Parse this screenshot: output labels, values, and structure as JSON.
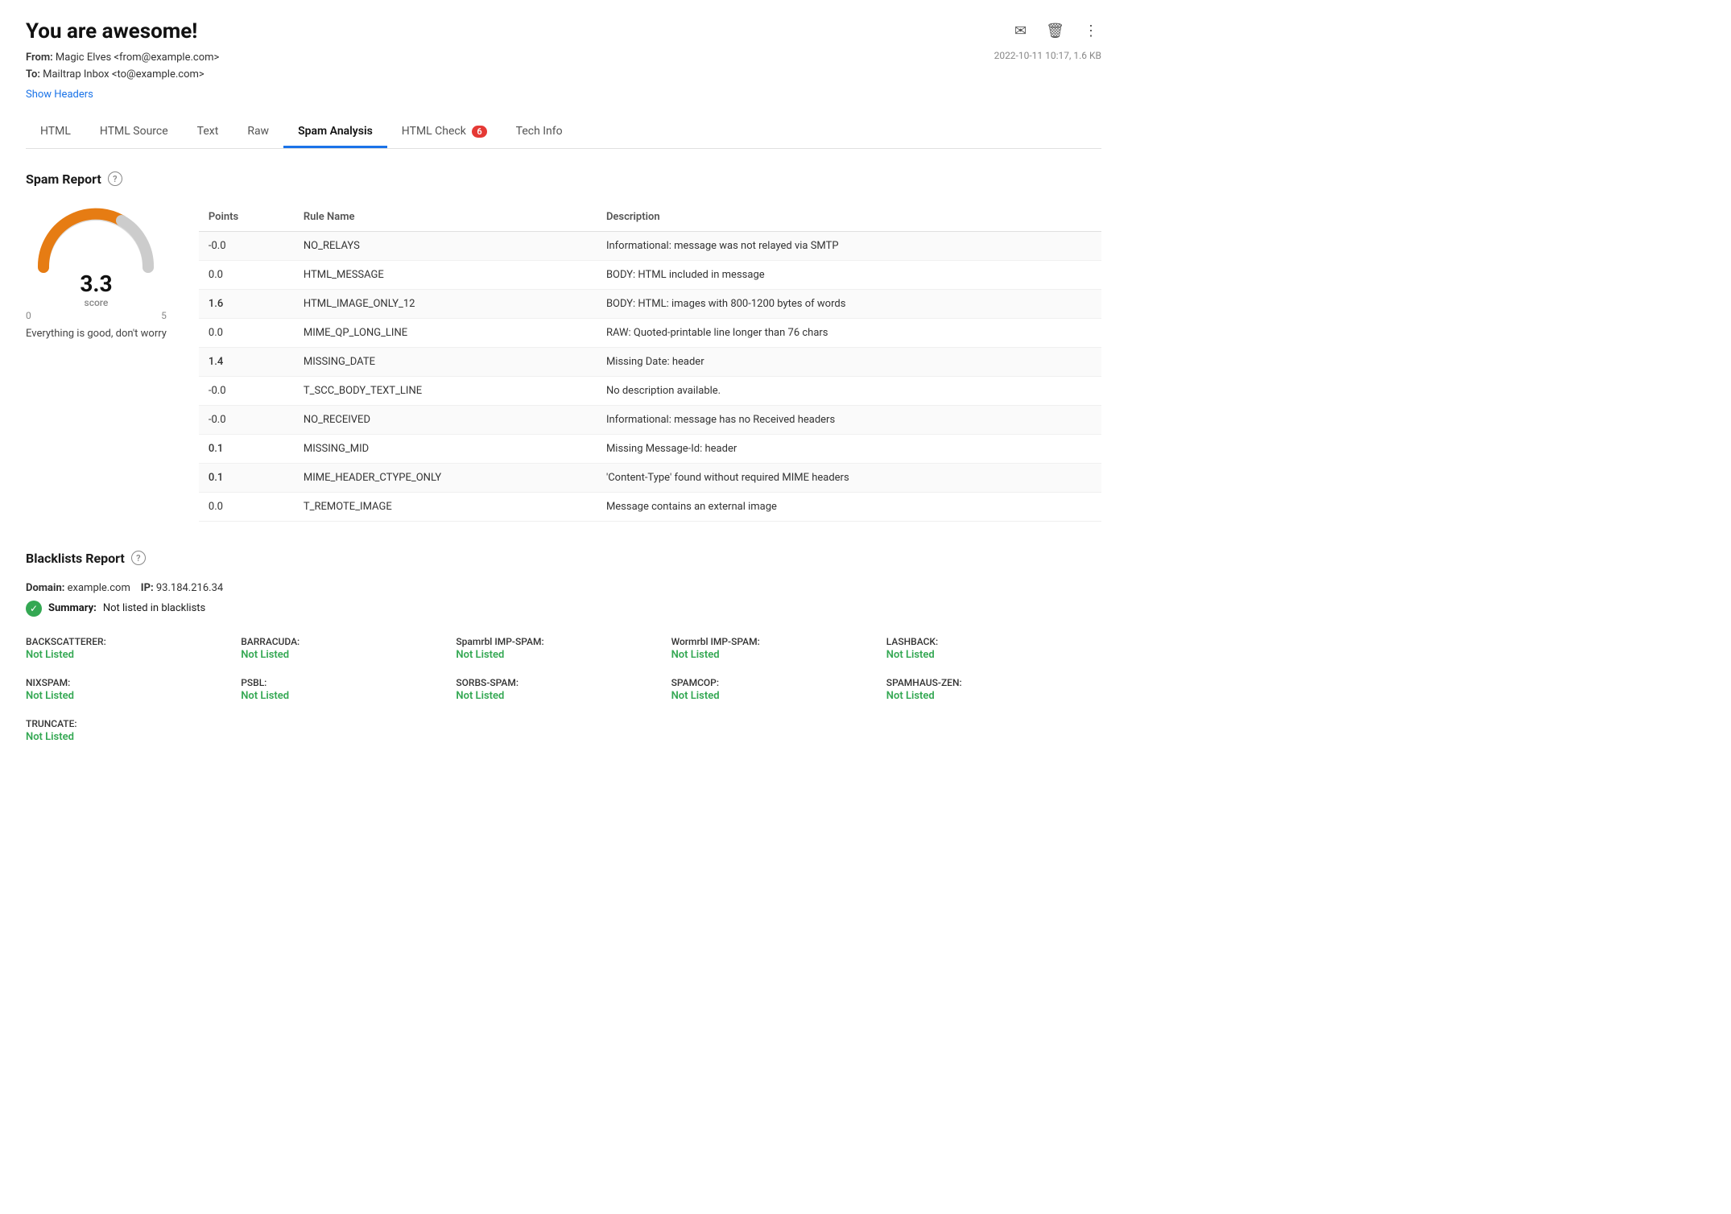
{
  "header": {
    "title": "You are awesome!",
    "from_label": "From:",
    "from_value": "Magic Elves <from@example.com>",
    "to_label": "To:",
    "to_value": "Mailtrap Inbox <to@example.com>",
    "show_headers": "Show Headers",
    "meta_right": "2022-10-11 10:17, 1.6 KB"
  },
  "tabs": [
    {
      "label": "HTML",
      "active": false
    },
    {
      "label": "HTML Source",
      "active": false
    },
    {
      "label": "Text",
      "active": false
    },
    {
      "label": "Raw",
      "active": false
    },
    {
      "label": "Spam Analysis",
      "active": true
    },
    {
      "label": "HTML Check",
      "active": false,
      "badge": "6"
    },
    {
      "label": "Tech Info",
      "active": false
    }
  ],
  "spam_report": {
    "title": "Spam Report",
    "score": "3.3",
    "score_label": "score",
    "gauge_min": "0",
    "gauge_max": "5",
    "description": "Everything is good, don't worry",
    "table_headers": [
      "Points",
      "Rule Name",
      "Description"
    ],
    "rows": [
      {
        "points": "-0.0",
        "orange": false,
        "rule": "NO_RELAYS",
        "description": "Informational: message was not relayed via SMTP"
      },
      {
        "points": "0.0",
        "orange": false,
        "rule": "HTML_MESSAGE",
        "description": "BODY: HTML included in message"
      },
      {
        "points": "1.6",
        "orange": true,
        "rule": "HTML_IMAGE_ONLY_12",
        "description": "BODY: HTML: images with 800-1200 bytes of words"
      },
      {
        "points": "0.0",
        "orange": false,
        "rule": "MIME_QP_LONG_LINE",
        "description": "RAW: Quoted-printable line longer than 76 chars"
      },
      {
        "points": "1.4",
        "orange": true,
        "rule": "MISSING_DATE",
        "description": "Missing Date: header"
      },
      {
        "points": "-0.0",
        "orange": false,
        "rule": "T_SCC_BODY_TEXT_LINE",
        "description": "No description available."
      },
      {
        "points": "-0.0",
        "orange": false,
        "rule": "NO_RECEIVED",
        "description": "Informational: message has no Received headers"
      },
      {
        "points": "0.1",
        "orange": true,
        "rule": "MISSING_MID",
        "description": "Missing Message-Id: header"
      },
      {
        "points": "0.1",
        "orange": true,
        "rule": "MIME_HEADER_CTYPE_ONLY",
        "description": "'Content-Type' found without required MIME headers"
      },
      {
        "points": "0.0",
        "orange": false,
        "rule": "T_REMOTE_IMAGE",
        "description": "Message contains an external image"
      }
    ]
  },
  "blacklists": {
    "title": "Blacklists Report",
    "domain_label": "Domain:",
    "domain_value": "example.com",
    "ip_label": "IP:",
    "ip_value": "93.184.216.34",
    "summary_label": "Summary:",
    "summary_value": "Not listed in blacklists",
    "items": [
      {
        "label": "BACKSCATTERER:",
        "value": "Not Listed"
      },
      {
        "label": "BARRACUDA:",
        "value": "Not Listed"
      },
      {
        "label": "Spamrbl IMP-SPAM:",
        "value": "Not Listed"
      },
      {
        "label": "Wormrbl IMP-SPAM:",
        "value": "Not Listed"
      },
      {
        "label": "LASHBACK:",
        "value": "Not Listed"
      },
      {
        "label": "NIXSPAM:",
        "value": "Not Listed"
      },
      {
        "label": "PSBL:",
        "value": "Not Listed"
      },
      {
        "label": "SORBS-SPAM:",
        "value": "Not Listed"
      },
      {
        "label": "SPAMCOP:",
        "value": "Not Listed"
      },
      {
        "label": "SPAMHAUS-ZEN:",
        "value": "Not Listed"
      },
      {
        "label": "TRUNCATE:",
        "value": "Not Listed"
      }
    ]
  },
  "icons": {
    "email": "✉",
    "trash": "🗑",
    "more": "⋮",
    "help": "?",
    "check": "✓"
  }
}
